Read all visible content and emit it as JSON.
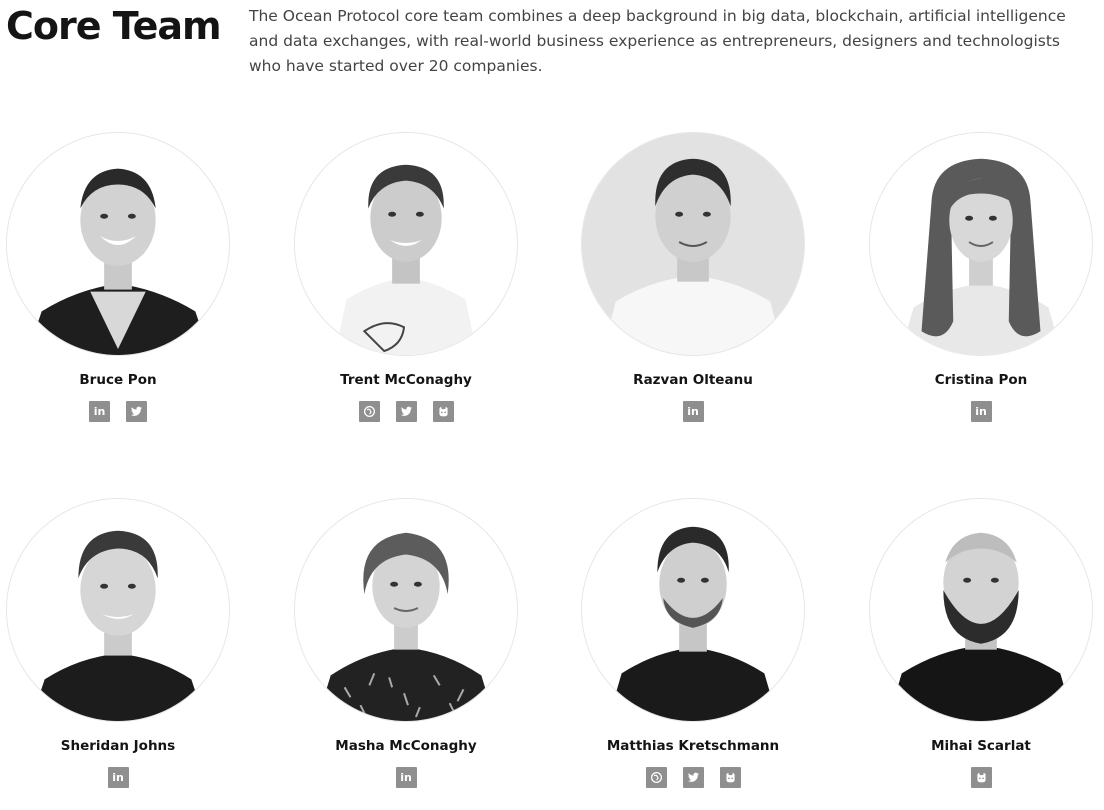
{
  "header": {
    "title": "Core Team",
    "description": "The Ocean Protocol core team combines a deep background in big data, blockchain, artificial intelligence and data exchanges, with real-world business experience as entrepreneurs, designers and technologists who have started over 20 companies."
  },
  "members": [
    {
      "name": "Bruce Pon",
      "links": [
        "linkedin-icon",
        "twitter-icon"
      ]
    },
    {
      "name": "Trent McConaghy",
      "links": [
        "website-icon",
        "twitter-icon",
        "github-icon"
      ]
    },
    {
      "name": "Razvan Olteanu",
      "links": [
        "linkedin-icon"
      ]
    },
    {
      "name": "Cristina Pon",
      "links": [
        "linkedin-icon"
      ]
    },
    {
      "name": "Sheridan Johns",
      "links": [
        "linkedin-icon"
      ]
    },
    {
      "name": "Masha McConaghy",
      "links": [
        "linkedin-icon"
      ]
    },
    {
      "name": "Matthias Kretschmann",
      "links": [
        "website-icon",
        "twitter-icon",
        "github-icon"
      ]
    },
    {
      "name": "Mihai Scarlat",
      "links": [
        "github-icon"
      ]
    }
  ],
  "colors": {
    "title": "#141414",
    "text": "#444444",
    "icon_bg": "#8f8f8f"
  }
}
